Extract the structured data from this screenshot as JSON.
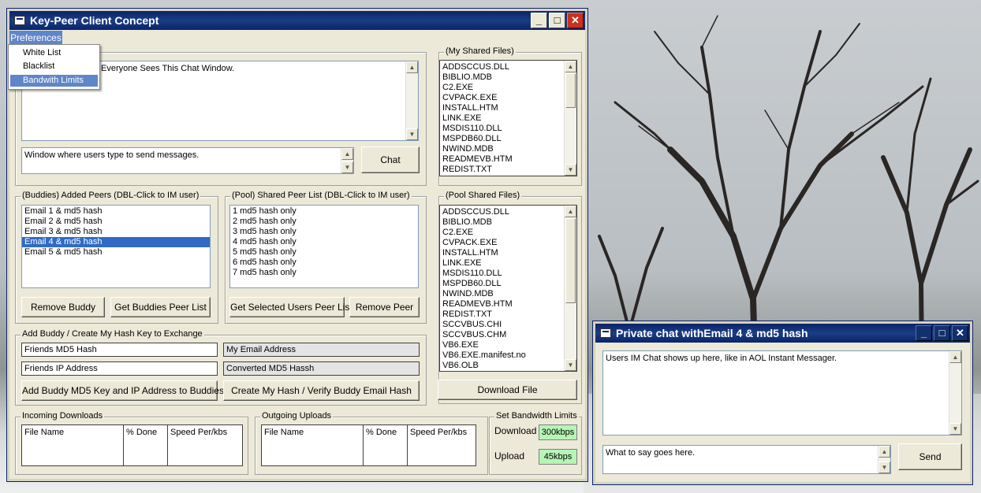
{
  "main_window": {
    "title": "Key-Peer Client Concept",
    "menu": {
      "preferences": "Preferences"
    },
    "dropdown": [
      "White List",
      "Blacklist",
      "Bandwith Limits"
    ],
    "chat_text": "Everyone Sees This Chat Window.",
    "message_input": "Window where users type to send messages.",
    "chat_button": "Chat",
    "my_shared_files": {
      "label": "(My Shared Files)",
      "items": [
        "ADDSCCUS.DLL",
        "BIBLIO.MDB",
        "C2.EXE",
        "CVPACK.EXE",
        "INSTALL.HTM",
        "LINK.EXE",
        "MSDIS110.DLL",
        "MSPDB60.DLL",
        "NWIND.MDB",
        "READMEVB.HTM",
        "REDIST.TXT"
      ]
    },
    "buddies": {
      "label": "(Buddies) Added Peers (DBL-Click to IM user)",
      "items": [
        "Email 1 & md5 hash",
        "Email 2 & md5 hash",
        "Email 3 & md5 hash",
        "Email 4 & md5 hash",
        "Email 5 & md5 hash"
      ],
      "remove_button": "Remove Buddy",
      "get_list_button": "Get Buddies Peer List"
    },
    "pool_peers": {
      "label": "(Pool) Shared Peer List (DBL-Click to IM user)",
      "items": [
        "1 md5 hash only",
        "2 md5 hash only",
        "3 md5 hash only",
        "4 md5 hash only",
        "5 md5 hash only",
        "6 md5 hash only",
        "7 md5 hash only"
      ],
      "get_selected_button": "Get Selected Users Peer List",
      "remove_button": "Remove Peer"
    },
    "pool_shared_files": {
      "label": "(Pool Shared Files)",
      "items": [
        "ADDSCCUS.DLL",
        "BIBLIO.MDB",
        "C2.EXE",
        "CVPACK.EXE",
        "INSTALL.HTM",
        "LINK.EXE",
        "MSDIS110.DLL",
        "MSPDB60.DLL",
        "NWIND.MDB",
        "READMEVB.HTM",
        "REDIST.TXT",
        "SCCVBUS.CHI",
        "SCCVBUS.CHM",
        "VB6.EXE",
        "VB6.EXE.manifest.no",
        "VB6.OLB"
      ],
      "download_button": "Download File"
    },
    "add_buddy": {
      "label": "Add Buddy / Create My Hash Key to Exchange",
      "friends_md5": "Friends MD5 Hash",
      "my_email": "My Email Address",
      "friends_ip": "Friends IP Address",
      "converted_md5": "Converted MD5 Hassh",
      "add_button": "Add Buddy MD5 Key and IP Address to Buddies",
      "create_button": "Create My Hash / Verify Buddy Email Hash"
    },
    "incoming": {
      "label": "Incoming Downloads",
      "columns": [
        "File Name",
        "% Done",
        "Speed Per/kbs"
      ]
    },
    "outgoing": {
      "label": "Outgoing Uploads",
      "columns": [
        "File Name",
        "% Done",
        "Speed Per/kbs"
      ]
    },
    "bandwidth": {
      "label": "Set Bandwidth Limits",
      "download_label": "Download",
      "download_value": "300kbps",
      "upload_label": "Upload",
      "upload_value": "45kbps"
    }
  },
  "private_window": {
    "title": "Private chat withEmail 4 & md5 hash",
    "chat_text": "Users IM Chat shows up here, like in AOL Instant Messager.",
    "input_text": "What to say goes here.",
    "send_button": "Send"
  },
  "colors": {
    "titlebar": "#0a246a",
    "selection": "#316ac5",
    "green_field": "#b5f5b5",
    "window_bg": "#ece9d8"
  }
}
